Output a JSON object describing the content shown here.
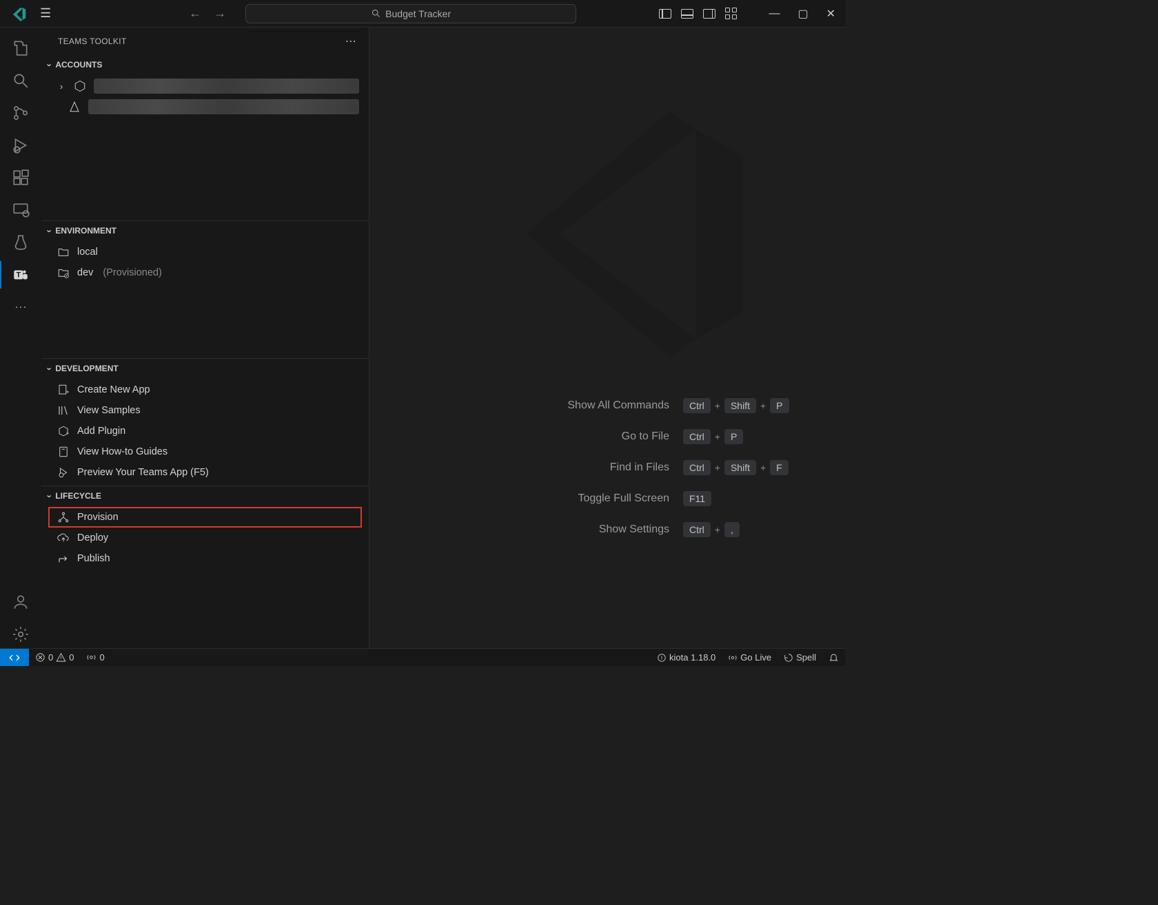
{
  "titlebar": {
    "command_center": "Budget Tracker"
  },
  "sidebar": {
    "title": "TEAMS TOOLKIT",
    "sections": {
      "accounts": {
        "header": "ACCOUNTS"
      },
      "environment": {
        "header": "ENVIRONMENT",
        "items": [
          {
            "name": "local",
            "status": ""
          },
          {
            "name": "dev",
            "status": "(Provisioned)"
          }
        ]
      },
      "development": {
        "header": "DEVELOPMENT",
        "items": [
          "Create New App",
          "View Samples",
          "Add Plugin",
          "View How-to Guides",
          "Preview Your Teams App (F5)"
        ]
      },
      "lifecycle": {
        "header": "LIFECYCLE",
        "items": [
          "Provision",
          "Deploy",
          "Publish"
        ]
      }
    }
  },
  "welcome": {
    "rows": [
      {
        "label": "Show All Commands",
        "keys": [
          "Ctrl",
          "Shift",
          "P"
        ]
      },
      {
        "label": "Go to File",
        "keys": [
          "Ctrl",
          "P"
        ]
      },
      {
        "label": "Find in Files",
        "keys": [
          "Ctrl",
          "Shift",
          "F"
        ]
      },
      {
        "label": "Toggle Full Screen",
        "keys": [
          "F11"
        ]
      },
      {
        "label": "Show Settings",
        "keys": [
          "Ctrl",
          ","
        ]
      }
    ]
  },
  "statusbar": {
    "errors": "0",
    "warnings": "0",
    "ports": "0",
    "kiota": "kiota 1.18.0",
    "golive": "Go Live",
    "spell": "Spell"
  }
}
